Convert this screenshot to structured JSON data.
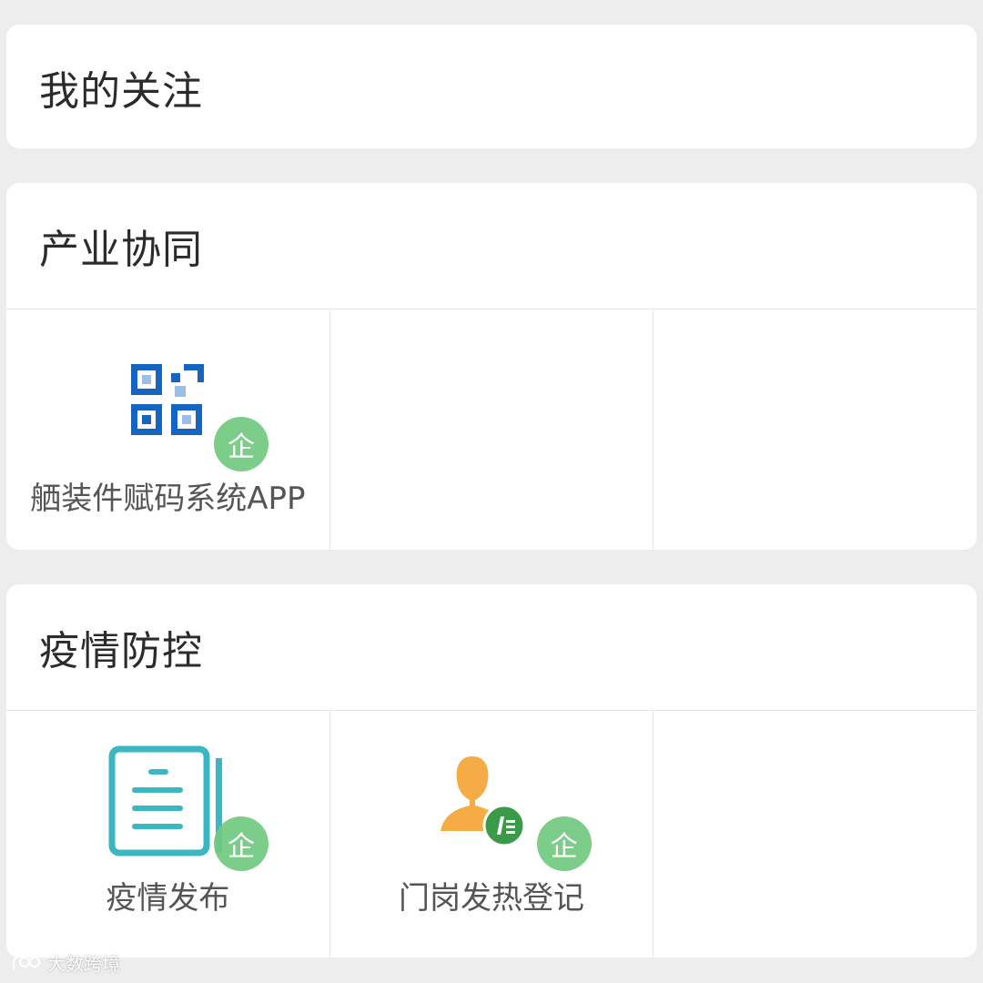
{
  "sections": [
    {
      "title": "我的关注"
    },
    {
      "title": "产业协同",
      "apps": [
        {
          "label": "舾装件赋码系统APP",
          "icon": "qr-code-icon",
          "badge": "企"
        }
      ]
    },
    {
      "title": "疫情防控",
      "apps": [
        {
          "label": "疫情发布",
          "icon": "document-list-icon",
          "badge": "企"
        },
        {
          "label": "门岗发热登记",
          "icon": "person-edit-icon",
          "badge": "企"
        }
      ]
    }
  ],
  "watermark": {
    "text": "大数跨境"
  },
  "colors": {
    "background": "#ededed",
    "card": "#ffffff",
    "badge": "#71c980",
    "qr_blue": "#1565c0",
    "doc_teal": "#3bb7c4",
    "person_orange": "#f6ac45",
    "edit_green": "#3a9a48"
  }
}
